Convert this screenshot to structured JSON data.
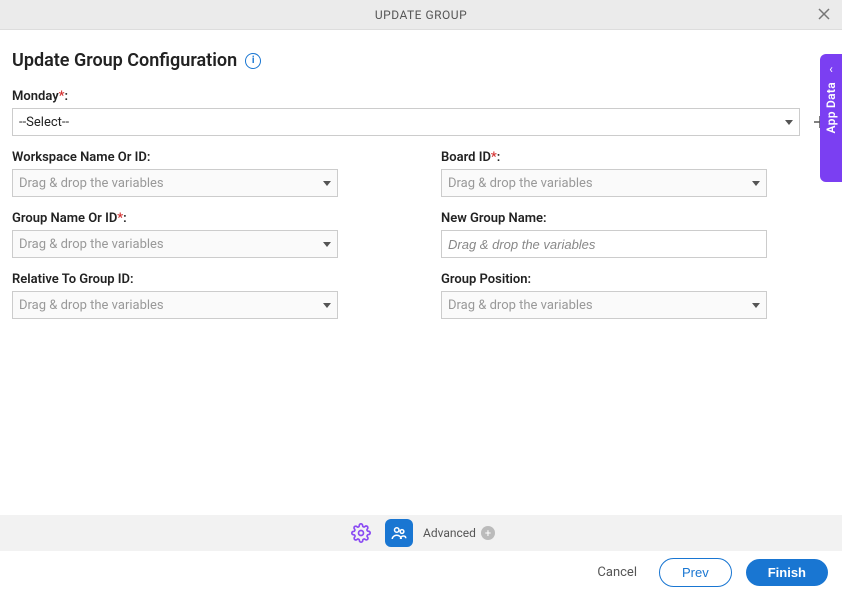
{
  "header": {
    "title": "UPDATE GROUP"
  },
  "page": {
    "title": "Update Group Configuration"
  },
  "fields": {
    "monday": {
      "label": "Monday",
      "required": true,
      "value": "--Select--"
    },
    "workspace": {
      "label": "Workspace Name Or ID:",
      "placeholder": "Drag & drop the variables"
    },
    "boardId": {
      "label": "Board ID",
      "required": true,
      "placeholder": "Drag & drop the variables"
    },
    "groupName": {
      "label": "Group Name Or ID",
      "required": true,
      "placeholder": "Drag & drop the variables"
    },
    "newGroupName": {
      "label": "New Group Name:",
      "placeholder": "Drag & drop the variables"
    },
    "relativeTo": {
      "label": "Relative To Group ID:",
      "placeholder": "Drag & drop the variables"
    },
    "position": {
      "label": "Group Position:",
      "placeholder": "Drag & drop the variables"
    }
  },
  "toolbar": {
    "advanced": "Advanced"
  },
  "footer": {
    "cancel": "Cancel",
    "prev": "Prev",
    "finish": "Finish"
  },
  "sidepanel": {
    "label": "App Data"
  }
}
